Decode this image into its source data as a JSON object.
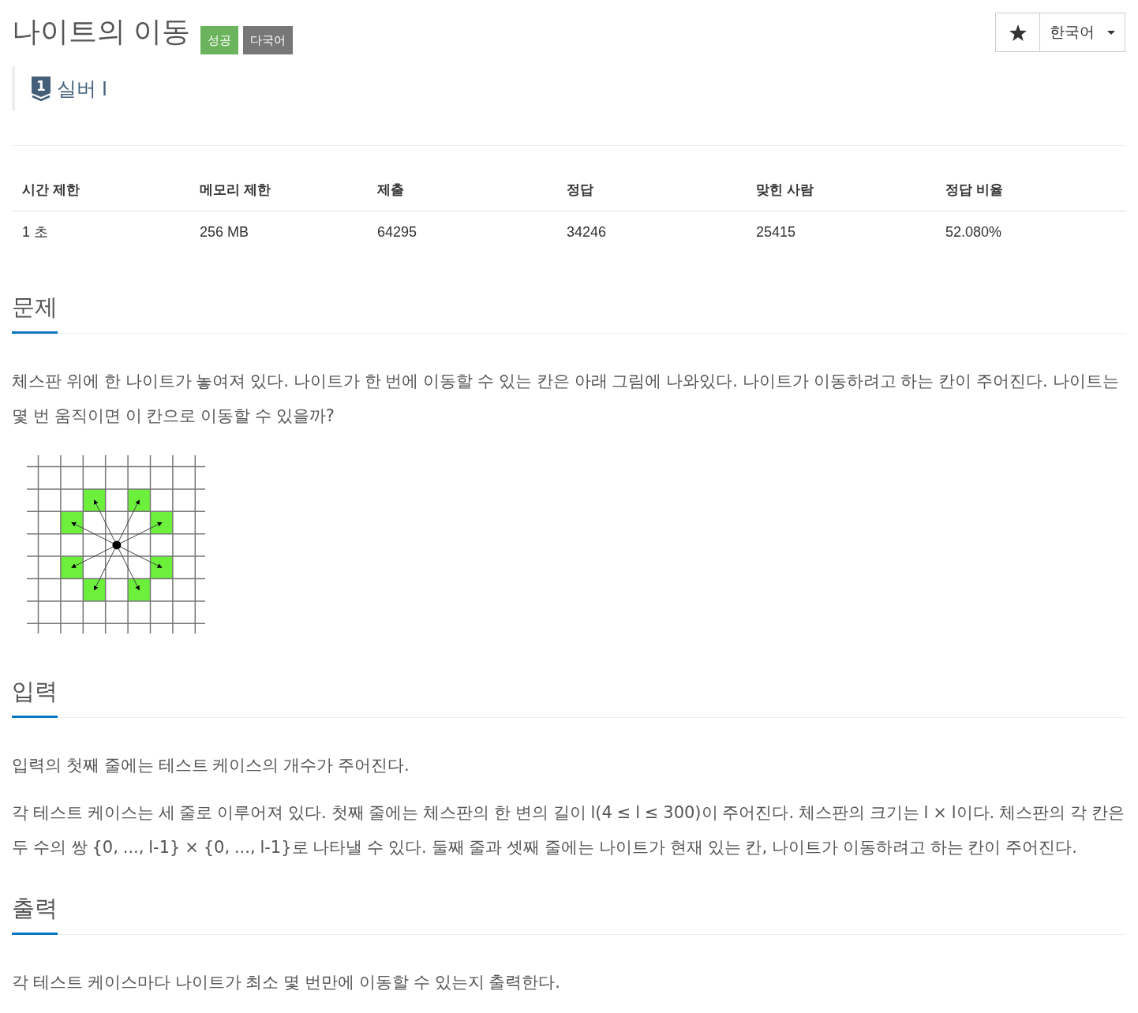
{
  "title": "나이트의 이동",
  "badges": [
    {
      "label": "성공",
      "kind": "success"
    },
    {
      "label": "다국어",
      "kind": "multilang"
    }
  ],
  "language_select": {
    "value": "한국어"
  },
  "tier": {
    "icon_label": "1",
    "name": "실버 I"
  },
  "stats_table": {
    "columns": [
      "시간 제한",
      "메모리 제한",
      "제출",
      "정답",
      "맞힌 사람",
      "정답 비율"
    ],
    "rows": [
      [
        "1 초",
        "256 MB",
        "64295",
        "34246",
        "25415",
        "52.080%"
      ]
    ]
  },
  "sections": [
    {
      "heading": "문제",
      "blocks": [
        {
          "kind": "text",
          "text": "체스판 위에 한 나이트가 놓여져 있다. 나이트가 한 번에 이동할 수 있는 칸은 아래 그림에 나와있다. 나이트가 이동하려고 하는 칸이 주어진다. 나이트는 몇 번 움직이면 이 칸으로 이동할 수 있을까?"
        },
        {
          "kind": "figure"
        }
      ]
    },
    {
      "heading": "입력",
      "blocks": [
        {
          "kind": "text",
          "text": "입력의 첫째 줄에는 테스트 케이스의 개수가 주어진다."
        },
        {
          "kind": "text",
          "text": "각 테스트 케이스는 세 줄로 이루어져 있다. 첫째 줄에는 체스판의 한 변의 길이 l(4 ≤ l ≤ 300)이 주어진다. 체스판의 크기는 l × l이다. 체스판의 각 칸은 두 수의 쌍 {0, ..., l-1} × {0, ..., l-1}로 나타낼 수 있다. 둘째 줄과 셋째 줄에는 나이트가 현재 있는 칸, 나이트가 이동하려고 하는 칸이 주어진다."
        }
      ]
    },
    {
      "heading": "출력",
      "blocks": [
        {
          "kind": "text",
          "text": "각 테스트 케이스마다 나이트가 최소 몇 번만에 이동할 수 있는지 출력한다."
        }
      ]
    }
  ]
}
